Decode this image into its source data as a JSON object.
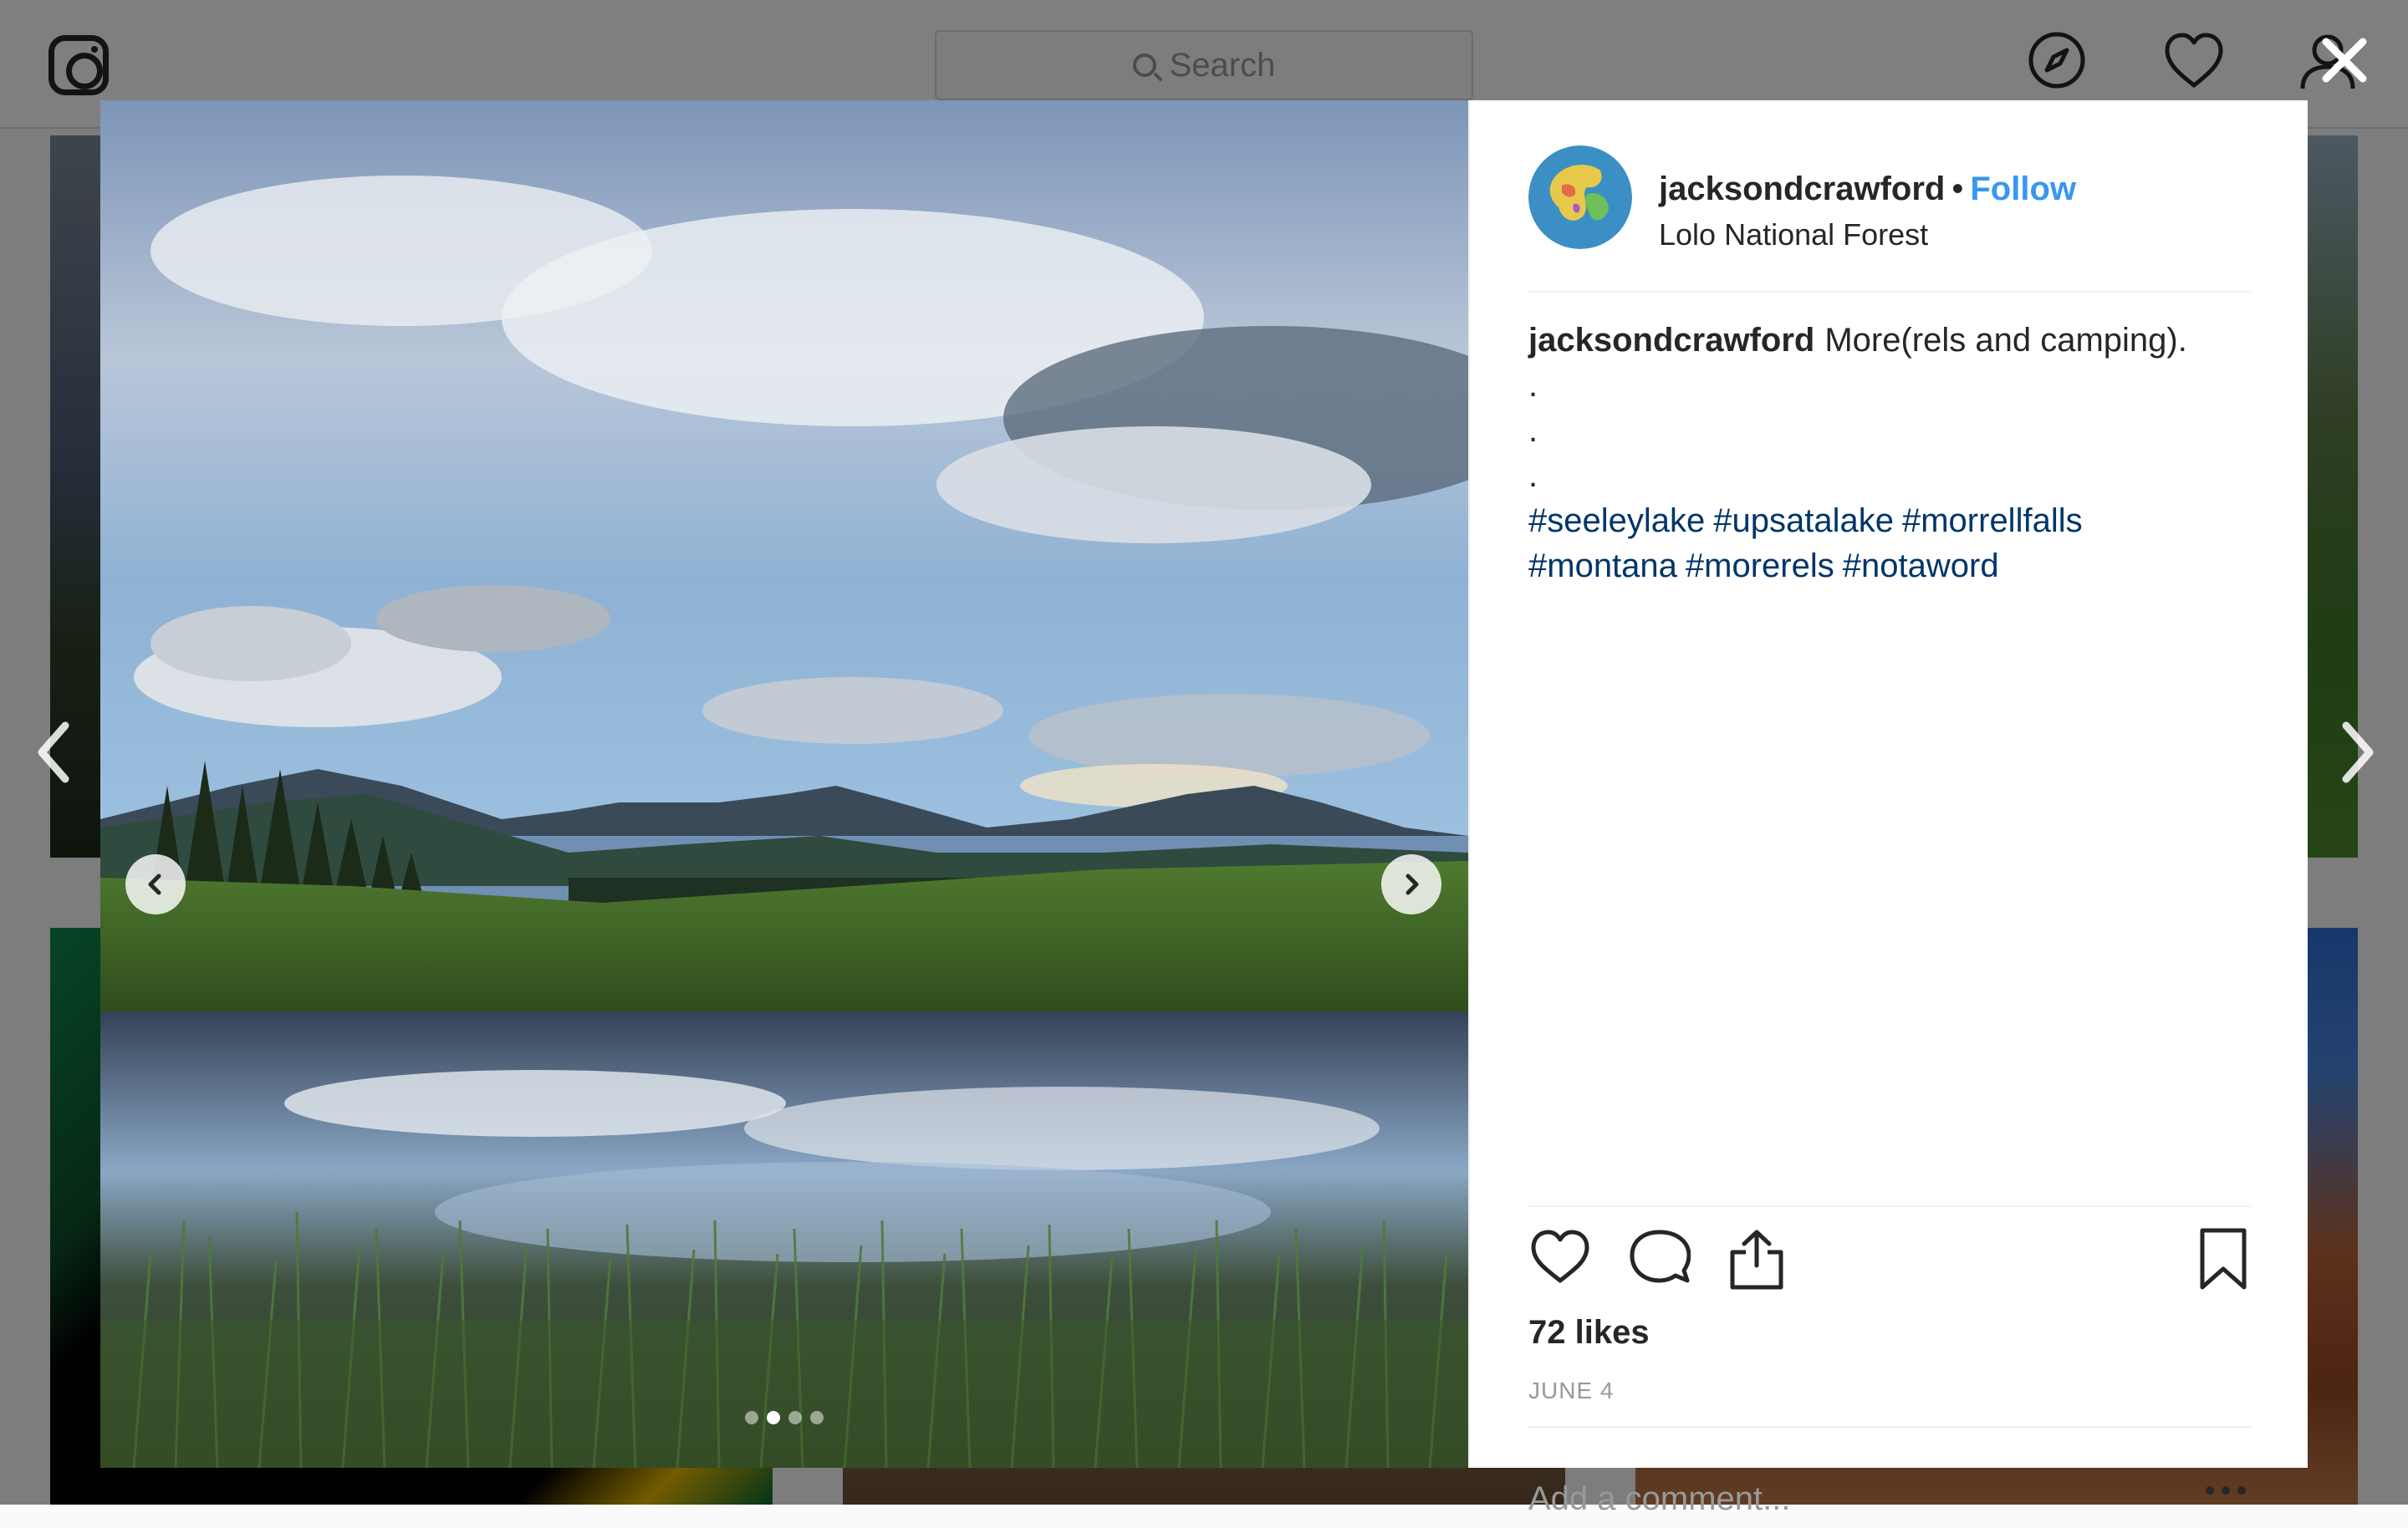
{
  "topbar": {
    "search_placeholder": "Search"
  },
  "post": {
    "username": "jacksondcrawford",
    "separator": "•",
    "follow_label": "Follow",
    "location": "Lolo National Forest",
    "caption": {
      "username": "jacksondcrawford",
      "text": "More(rels and camping).",
      "dot_lines": [
        ".",
        ".",
        "."
      ],
      "hashtags": [
        "#seeleylake",
        "#upsatalake",
        "#morrellfalls",
        "#montana",
        "#morerels",
        "#notaword"
      ]
    },
    "likes": "72 likes",
    "date": "JUNE 4",
    "comment_placeholder": "Add a comment...",
    "carousel": {
      "total": 4,
      "current": 2
    }
  },
  "icons": {
    "logo": "instagram-logo-icon",
    "search": "search-icon",
    "explore": "compass-icon",
    "activity": "heart-icon",
    "profile": "user-icon",
    "close": "close-icon",
    "like": "heart-outline-icon",
    "comment": "comment-bubble-icon",
    "share": "share-icon",
    "save": "bookmark-icon",
    "options": "more-options-icon"
  },
  "colors": {
    "link_blue": "#3897f0",
    "hashtag": "#003569",
    "overlay": "rgba(0,0,0,0.5)"
  }
}
